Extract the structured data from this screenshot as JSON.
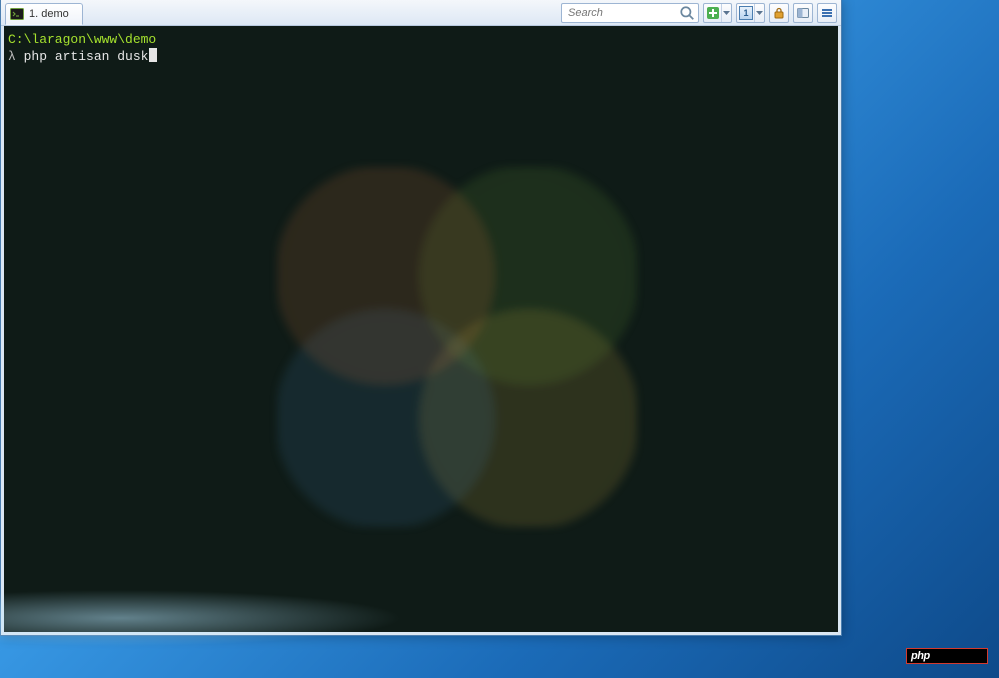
{
  "tab": {
    "label": "1. demo"
  },
  "toolbar": {
    "search_placeholder": "Search",
    "tab_number": "1"
  },
  "terminal": {
    "cwd": "C:\\laragon\\www\\demo",
    "prompt": "λ ",
    "command": "php artisan dusk"
  },
  "tray": {
    "badge_text": "php"
  }
}
